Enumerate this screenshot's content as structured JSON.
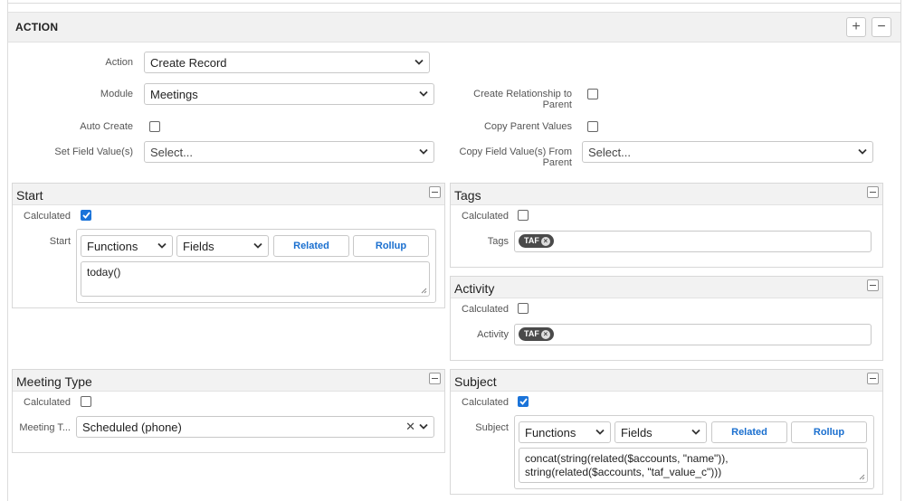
{
  "action": {
    "title": "ACTION",
    "add_label": "+",
    "remove_label": "−",
    "fields": {
      "action_label": "Action",
      "action_value": "Create Record",
      "module_label": "Module",
      "module_value": "Meetings",
      "auto_create_label": "Auto Create",
      "auto_create_checked": false,
      "set_field_label": "Set Field Value(s)",
      "set_field_value": "Select...",
      "create_rel_label_1": "Create Relationship to",
      "create_rel_label_2": "Parent",
      "create_rel_checked": false,
      "copy_parent_label": "Copy Parent Values",
      "copy_parent_checked": false,
      "copy_field_label_1": "Copy Field Value(s) From",
      "copy_field_label_2": "Parent",
      "copy_field_value": "Select..."
    }
  },
  "panels": {
    "start": {
      "title": "Start",
      "calculated_label": "Calculated",
      "calculated_checked": true,
      "field_label": "Start",
      "functions_label": "Functions",
      "fields_label": "Fields",
      "related_label": "Related",
      "rollup_label": "Rollup",
      "formula": "today()"
    },
    "tags": {
      "title": "Tags",
      "calculated_label": "Calculated",
      "calculated_checked": false,
      "field_label": "Tags",
      "tag": "TAF",
      "tag_remove": "×"
    },
    "activity": {
      "title": "Activity",
      "calculated_label": "Calculated",
      "calculated_checked": false,
      "field_label": "Activity",
      "tag": "TAF",
      "tag_remove": "×"
    },
    "meeting_type": {
      "title": "Meeting Type",
      "calculated_label": "Calculated",
      "calculated_checked": false,
      "field_label": "Meeting T...",
      "value": "Scheduled (phone)",
      "clear": "✕"
    },
    "subject": {
      "title": "Subject",
      "calculated_label": "Calculated",
      "calculated_checked": true,
      "field_label": "Subject",
      "functions_label": "Functions",
      "fields_label": "Fields",
      "related_label": "Related",
      "rollup_label": "Rollup",
      "formula_line1": "concat(string(related($accounts, \"name\")),",
      "formula_line2": "string(related($accounts, \"taf_value_c\")))"
    }
  },
  "colors": {
    "accent": "#1a73d9",
    "header_bg": "#f1f1f1",
    "tag_bg": "#4a4a4a"
  }
}
